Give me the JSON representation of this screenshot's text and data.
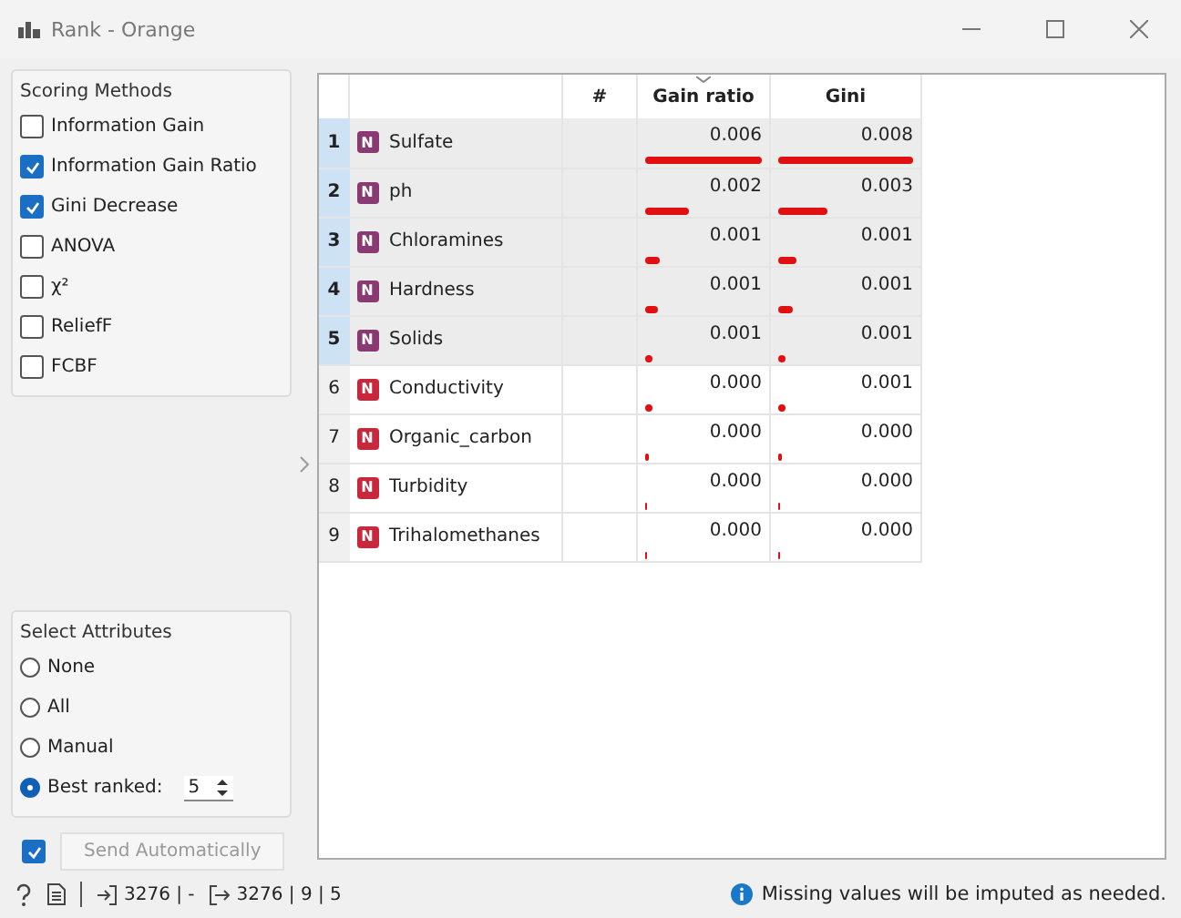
{
  "window": {
    "title": "Rank - Orange"
  },
  "scoring_methods": {
    "title": "Scoring Methods",
    "items": [
      {
        "label": "Information Gain",
        "checked": false
      },
      {
        "label": "Information Gain Ratio",
        "checked": true
      },
      {
        "label": "Gini Decrease",
        "checked": true
      },
      {
        "label": "ANOVA",
        "checked": false
      },
      {
        "label": "χ²",
        "checked": false
      },
      {
        "label": "ReliefF",
        "checked": false
      },
      {
        "label": "FCBF",
        "checked": false
      }
    ]
  },
  "select_attributes": {
    "title": "Select Attributes",
    "options": [
      {
        "label": "None",
        "selected": false
      },
      {
        "label": "All",
        "selected": false
      },
      {
        "label": "Manual",
        "selected": false
      },
      {
        "label": "Best ranked:",
        "selected": true
      }
    ],
    "best_ranked_value": "5"
  },
  "send_automatically": {
    "label": "Send Automatically",
    "checked": true
  },
  "table": {
    "columns": [
      {
        "label": "#",
        "sorted": false
      },
      {
        "label": "Gain ratio",
        "sorted": true
      },
      {
        "label": "Gini",
        "sorted": false
      }
    ],
    "rows": [
      {
        "index": "1",
        "type": "N",
        "name": "Sulfate",
        "selected": true,
        "scores": [
          {
            "value": "0.006",
            "level": 1.0
          },
          {
            "value": "0.008",
            "level": 1.0
          }
        ]
      },
      {
        "index": "2",
        "type": "N",
        "name": "ph",
        "selected": true,
        "scores": [
          {
            "value": "0.002",
            "level": 0.37
          },
          {
            "value": "0.003",
            "level": 0.37
          }
        ]
      },
      {
        "index": "3",
        "type": "N",
        "name": "Chloramines",
        "selected": true,
        "scores": [
          {
            "value": "0.001",
            "level": 0.13
          },
          {
            "value": "0.001",
            "level": 0.13
          }
        ]
      },
      {
        "index": "4",
        "type": "N",
        "name": "Hardness",
        "selected": true,
        "scores": [
          {
            "value": "0.001",
            "level": 0.11
          },
          {
            "value": "0.001",
            "level": 0.11
          }
        ]
      },
      {
        "index": "5",
        "type": "N",
        "name": "Solids",
        "selected": true,
        "scores": [
          {
            "value": "0.001",
            "level": 0.06
          },
          {
            "value": "0.001",
            "level": 0.06
          }
        ]
      },
      {
        "index": "6",
        "type": "N",
        "name": "Conductivity",
        "selected": false,
        "scores": [
          {
            "value": "0.000",
            "level": 0.06
          },
          {
            "value": "0.001",
            "level": 0.06
          }
        ]
      },
      {
        "index": "7",
        "type": "N",
        "name": "Organic_carbon",
        "selected": false,
        "scores": [
          {
            "value": "0.000",
            "level": 0.03
          },
          {
            "value": "0.000",
            "level": 0.03
          }
        ]
      },
      {
        "index": "8",
        "type": "N",
        "name": "Turbidity",
        "selected": false,
        "scores": [
          {
            "value": "0.000",
            "level": 0.01
          },
          {
            "value": "0.000",
            "level": 0.01
          }
        ]
      },
      {
        "index": "9",
        "type": "N",
        "name": "Trihalomethanes",
        "selected": false,
        "scores": [
          {
            "value": "0.000",
            "level": 0.01
          },
          {
            "value": "0.000",
            "level": 0.01
          }
        ]
      }
    ]
  },
  "status_bar": {
    "input": "3276 | -",
    "output": "3276 | 9 | 5",
    "message": "Missing values will be imputed as needed."
  }
}
